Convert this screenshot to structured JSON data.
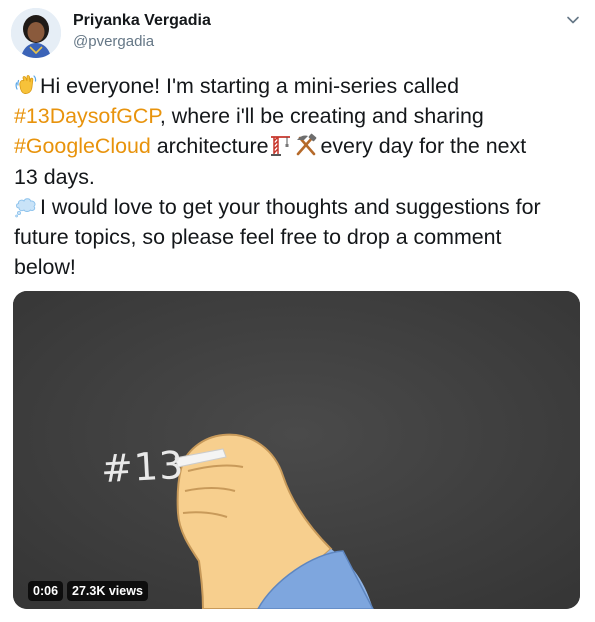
{
  "author": {
    "display_name": "Priyanka Vergadia",
    "handle": "@pvergadia",
    "avatar_icon": "avatar-photo"
  },
  "tweet": {
    "lines": [
      {
        "emoji": "waving-hand-icon",
        "parts": [
          {
            "text": "Hi everyone! I'm starting a mini-series called",
            "hashtag": false
          }
        ]
      },
      {
        "parts": [
          {
            "text": "#13DaysofGCP",
            "hashtag": true
          },
          {
            "text": ", where i'll be creating and sharing",
            "hashtag": false
          }
        ]
      },
      {
        "parts": [
          {
            "text": "#GoogleCloud",
            "hashtag": true
          },
          {
            "text": " architecture",
            "hashtag": false
          }
        ],
        "emojis_after": [
          "construction-crane-icon",
          "hammer-and-pick-icon"
        ],
        "tail": "every day for the next"
      },
      {
        "parts": [
          {
            "text": "13 days.",
            "hashtag": false
          }
        ]
      },
      {
        "emoji": "thought-balloon-icon",
        "parts": [
          {
            "text": "I would love to get your thoughts and suggestions for",
            "hashtag": false
          }
        ]
      },
      {
        "parts": [
          {
            "text": "future topics, so please feel free to drop a comment",
            "hashtag": false
          }
        ]
      },
      {
        "parts": [
          {
            "text": "below!",
            "hashtag": false
          }
        ]
      }
    ]
  },
  "media": {
    "chalk_text": "#13",
    "duration": "0:06",
    "views": "27.3K views"
  },
  "colors": {
    "hashtag": "#e8930c",
    "text": "#14171a",
    "secondary": "#657786",
    "chalkboard": "#3f3f3f"
  }
}
